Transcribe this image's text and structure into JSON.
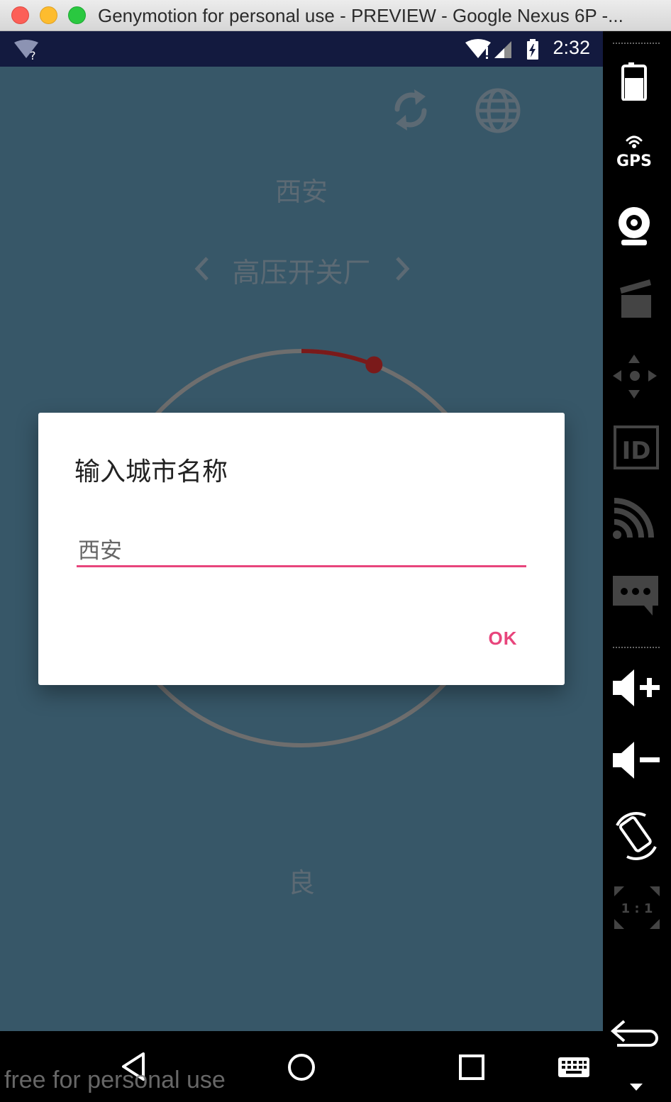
{
  "window": {
    "title": "Genymotion for personal use - PREVIEW - Google Nexus 6P -..."
  },
  "status_bar": {
    "time": "2:32"
  },
  "app": {
    "city": "西安",
    "station": "高压开关厂",
    "air_quality": "良",
    "gauge_level": 0.06,
    "colors": {
      "background": "#375768",
      "gauge_track": "#6e6e6e",
      "gauge_value": "#7a1a1a"
    }
  },
  "dialog": {
    "title": "输入城市名称",
    "input_value": "西安",
    "ok_label": "OK",
    "accent": "#e8457c"
  },
  "watermark": "free for personal use",
  "sidebar": {
    "gps_label": "GPS",
    "id_label": "ID",
    "scale_label": "1 : 1"
  }
}
